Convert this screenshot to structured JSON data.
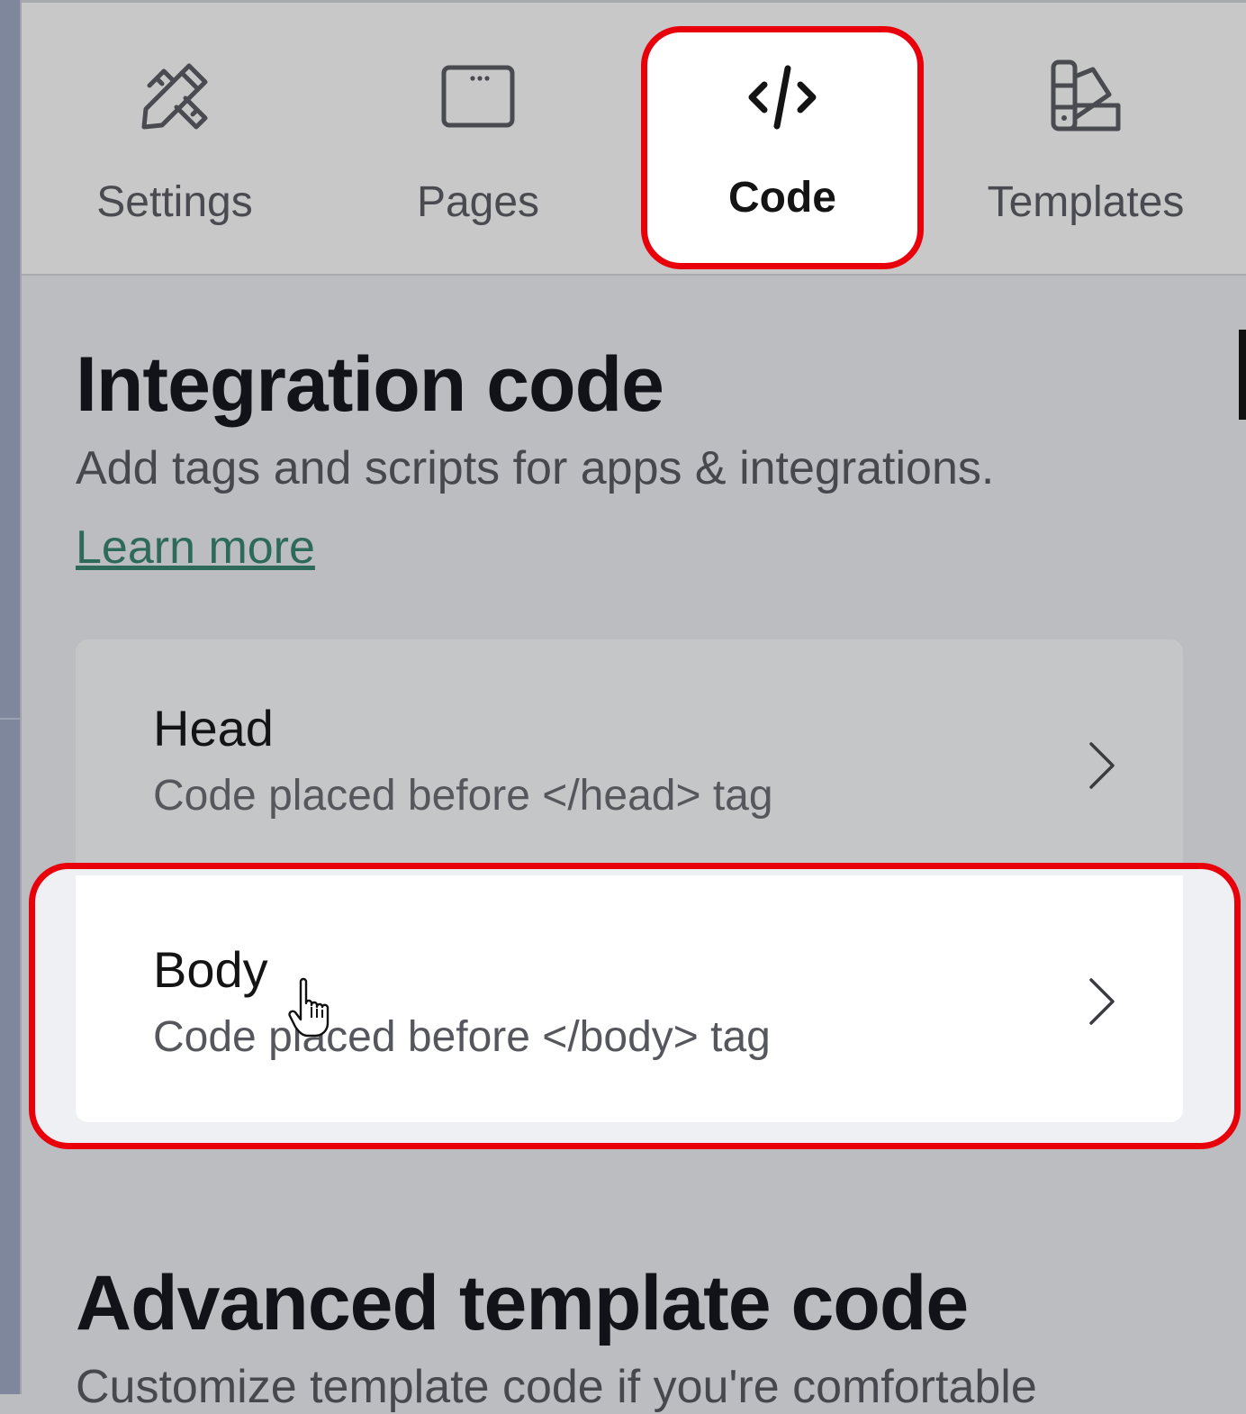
{
  "tabs": [
    {
      "label": "Settings",
      "icon": "pencil-ruler-icon"
    },
    {
      "label": "Pages",
      "icon": "browser-window-icon"
    },
    {
      "label": "Code",
      "icon": "code-brackets-icon",
      "active": true
    },
    {
      "label": "Templates",
      "icon": "template-swatch-icon"
    }
  ],
  "integration": {
    "title": "Integration code",
    "description": "Add tags and scripts for apps & integrations.",
    "learn_more": "Learn more"
  },
  "rows": {
    "head": {
      "title": "Head",
      "subtitle": "Code placed before </head> tag"
    },
    "body": {
      "title": "Body",
      "subtitle": "Code placed before </body> tag"
    }
  },
  "advanced": {
    "title": "Advanced template code",
    "description": "Customize template code if you're comfortable"
  },
  "colors": {
    "highlight": "#e8000b",
    "link": "#2e6a5a",
    "panel_bg": "#bcbdc1"
  }
}
